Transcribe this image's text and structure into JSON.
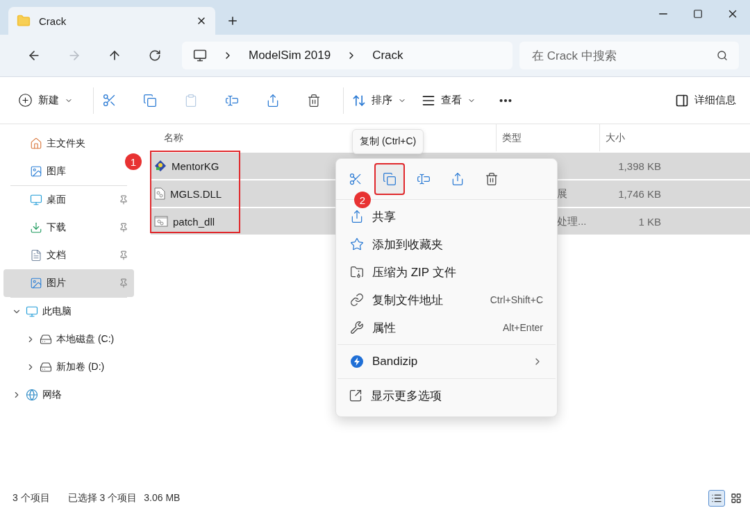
{
  "tab": {
    "title": "Crack",
    "selected": true
  },
  "address": {
    "path": [
      "ModelSim 2019",
      "Crack"
    ]
  },
  "search": {
    "placeholder": "在 Crack 中搜索"
  },
  "toolbar": {
    "new": "新建",
    "sort": "排序",
    "view": "查看",
    "details": "详细信息"
  },
  "sidebar": {
    "quick": [
      {
        "label": "主文件夹",
        "pinned": false,
        "selected": false
      },
      {
        "label": "图库",
        "pinned": false,
        "selected": false
      }
    ],
    "pinned": [
      {
        "label": "桌面",
        "pinned": true,
        "selected": false
      },
      {
        "label": "下载",
        "pinned": true,
        "selected": false
      },
      {
        "label": "文档",
        "pinned": true,
        "selected": false
      },
      {
        "label": "图片",
        "pinned": true,
        "selected": true
      }
    ],
    "tree": [
      {
        "label": "此电脑",
        "expanded": true,
        "children": [
          {
            "label": "本地磁盘 (C:)",
            "expanded": false
          },
          {
            "label": "新加卷 (D:)",
            "expanded": false
          }
        ]
      },
      {
        "label": "网络",
        "expanded": false
      }
    ]
  },
  "columns": {
    "name": "名称",
    "type": "类型",
    "size": "大小"
  },
  "rows": [
    {
      "name": "MentorKG",
      "size": "1,398 KB",
      "selected": true
    },
    {
      "name": "MGLS.DLL",
      "type": "展",
      "size": "1,746 KB",
      "selected": true
    },
    {
      "name": "patch_dll",
      "type": "处理...",
      "size": "1 KB",
      "selected": true
    }
  ],
  "tooltip": "复制 (Ctrl+C)",
  "context_menu": {
    "actions": [
      {
        "highlighted": false
      },
      {
        "highlighted": true
      },
      {
        "highlighted": false
      },
      {
        "highlighted": false
      },
      {
        "highlighted": false
      }
    ],
    "groups": [
      [
        {
          "kind": "command",
          "label": "共享"
        },
        {
          "kind": "command",
          "label": "添加到收藏夹"
        },
        {
          "kind": "command",
          "label": "压缩为 ZIP 文件"
        },
        {
          "kind": "command",
          "label": "复制文件地址",
          "shortcut": "Ctrl+Shift+C"
        },
        {
          "kind": "command",
          "label": "属性",
          "shortcut": "Alt+Enter"
        }
      ],
      [
        {
          "kind": "submenu",
          "label": "Bandizip"
        }
      ],
      [
        {
          "kind": "command",
          "label": "显示更多选项"
        }
      ]
    ]
  },
  "annotations": [
    "1",
    "2"
  ],
  "status_bar": {
    "count": "3 个项目",
    "selection": "已选择 3 个项目",
    "size": "3.06 MB",
    "views": [
      {
        "selected": true
      },
      {
        "selected": false
      }
    ]
  }
}
